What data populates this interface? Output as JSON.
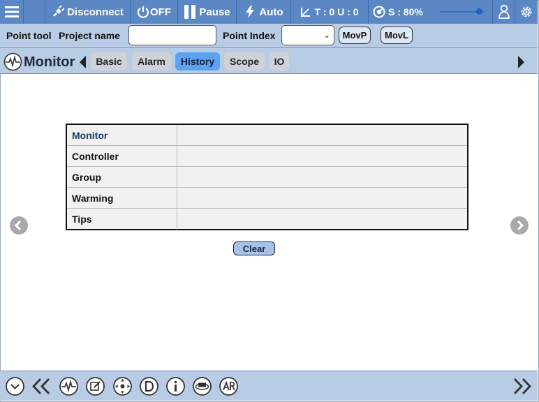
{
  "topbar": {
    "disconnect_label": "Disconnect",
    "power_label": "OFF",
    "pause_label": "Pause",
    "mode_label": "Auto",
    "tool_status": "T : 0 U : 0",
    "speed_label": "S : 80%",
    "speed_percent": 80
  },
  "toolbar2": {
    "point_tool_label": "Point tool",
    "project_name_label": "Project name",
    "project_name_value": "",
    "point_index_label": "Point Index",
    "point_index_value": "",
    "movp_label": "MovP",
    "movl_label": "MovL"
  },
  "tabs": {
    "title": "Monitor",
    "items": [
      {
        "label": "Basic"
      },
      {
        "label": "Alarm"
      },
      {
        "label": "History"
      },
      {
        "label": "Scope"
      },
      {
        "label": "IO"
      }
    ],
    "active": "History"
  },
  "history_table": {
    "rows": [
      {
        "label": "Monitor",
        "value": ""
      },
      {
        "label": "Controller",
        "value": ""
      },
      {
        "label": "Group",
        "value": ""
      },
      {
        "label": "Warming",
        "value": ""
      },
      {
        "label": "Tips",
        "value": ""
      }
    ],
    "clear_label": "Clear"
  },
  "colors": {
    "topbar": "#5b87c4",
    "toolbar": "#b9cce6",
    "active_tab": "#5ba2f0",
    "tab": "#cfd3d9"
  },
  "icons": {
    "bottom": [
      "collapse-circle-icon",
      "double-chevron-left-icon",
      "waveform-icon",
      "edit-icon",
      "jog-icon",
      "d-badge-icon",
      "info-icon",
      "360-view-icon",
      "ar-icon"
    ]
  }
}
